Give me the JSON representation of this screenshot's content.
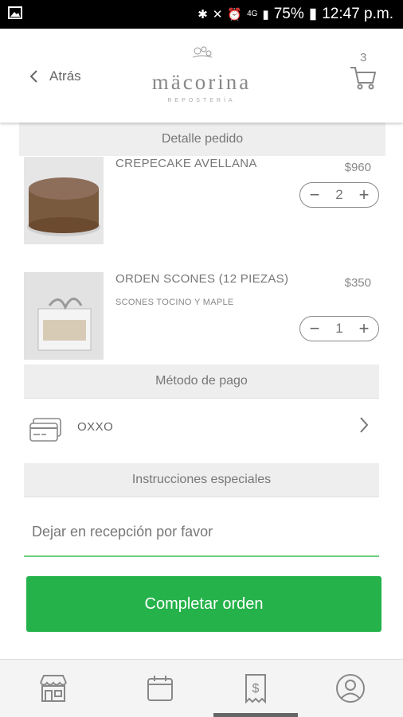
{
  "status_bar": {
    "battery": "75%",
    "time": "12:47 p.m.",
    "network": "4G"
  },
  "header": {
    "back_label": "Atrás",
    "brand_name": "mäcorina",
    "brand_tagline": "REPOSTERÍA",
    "cart_count": "3"
  },
  "order_detail": {
    "title": "Detalle pedido",
    "items": [
      {
        "name": "CREPECAKE AVELLANA",
        "subtitle": "",
        "price": "$960",
        "quantity": "2"
      },
      {
        "name": "ORDEN SCONES (12 PIEZAS)",
        "subtitle": "SCONES TOCINO Y MAPLE",
        "price": "$350",
        "quantity": "1"
      }
    ]
  },
  "payment": {
    "title": "Método de pago",
    "method": "OXXO"
  },
  "instructions": {
    "title": "Instrucciones especiales",
    "value": "Dejar en recepción por favor"
  },
  "cta": {
    "label": "Completar orden"
  },
  "colors": {
    "primary": "#25b24a",
    "input_underline": "#6fcf7f",
    "section_bg": "#eeeeee"
  },
  "icons": [
    "back-chevron-icon",
    "cart-icon",
    "credit-card-icon",
    "chevron-right-icon",
    "store-icon",
    "calendar-icon",
    "receipt-icon",
    "profile-icon"
  ]
}
